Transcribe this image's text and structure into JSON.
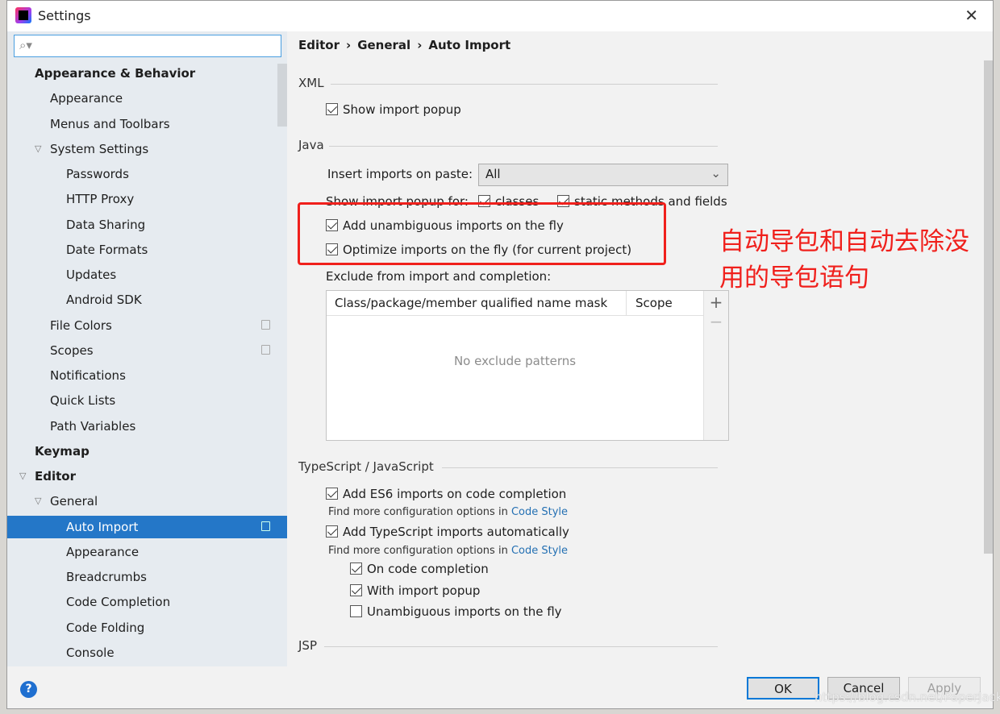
{
  "window": {
    "title": "Settings",
    "close": "✕"
  },
  "sidebar": {
    "search_placeholder": "",
    "items": [
      {
        "label": "Appearance & Behavior",
        "level": 0,
        "bold": true
      },
      {
        "label": "Appearance",
        "level": 1
      },
      {
        "label": "Menus and Toolbars",
        "level": 1
      },
      {
        "label": "System Settings",
        "level": 1,
        "expanded": true
      },
      {
        "label": "Passwords",
        "level": 2
      },
      {
        "label": "HTTP Proxy",
        "level": 2
      },
      {
        "label": "Data Sharing",
        "level": 2
      },
      {
        "label": "Date Formats",
        "level": 2
      },
      {
        "label": "Updates",
        "level": 2
      },
      {
        "label": "Android SDK",
        "level": 2
      },
      {
        "label": "File Colors",
        "level": 1,
        "copy": true
      },
      {
        "label": "Scopes",
        "level": 1,
        "copy": true
      },
      {
        "label": "Notifications",
        "level": 1
      },
      {
        "label": "Quick Lists",
        "level": 1
      },
      {
        "label": "Path Variables",
        "level": 1
      },
      {
        "label": "Keymap",
        "level": 0,
        "bold": true
      },
      {
        "label": "Editor",
        "level": 0,
        "bold": true,
        "expanded": true
      },
      {
        "label": "General",
        "level": 1,
        "expanded": true
      },
      {
        "label": "Auto Import",
        "level": 2,
        "selected": true,
        "copy": true
      },
      {
        "label": "Appearance",
        "level": 2
      },
      {
        "label": "Breadcrumbs",
        "level": 2
      },
      {
        "label": "Code Completion",
        "level": 2
      },
      {
        "label": "Code Folding",
        "level": 2
      },
      {
        "label": "Console",
        "level": 2
      }
    ]
  },
  "breadcrumb": [
    "Editor",
    "General",
    "Auto Import"
  ],
  "breadcrumb_sep": "›",
  "xml": {
    "title": "XML",
    "show_popup": {
      "label": "Show import popup",
      "checked": true
    }
  },
  "java": {
    "title": "Java",
    "insert_label": "Insert imports on paste:",
    "insert_value": "All",
    "popup_for_label": "Show import popup for:",
    "classes": {
      "label": "classes",
      "checked": true
    },
    "static": {
      "label": "static methods and fields",
      "checked": true
    },
    "unambiguous": {
      "label": "Add unambiguous imports on the fly",
      "checked": true
    },
    "optimize": {
      "label": "Optimize imports on the fly (for current project)",
      "checked": true
    },
    "exclude_label": "Exclude from import and completion:",
    "table": {
      "col1": "Class/package/member qualified name mask",
      "col2": "Scope",
      "empty": "No exclude patterns",
      "add": "+",
      "remove": "−"
    }
  },
  "ts": {
    "title": "TypeScript / JavaScript",
    "es6": {
      "label": "Add ES6 imports on code completion",
      "checked": true
    },
    "hint_text": "Find more configuration options in ",
    "hint_link": "Code Style",
    "tsauto": {
      "label": "Add TypeScript imports automatically",
      "checked": true
    },
    "on_completion": {
      "label": "On code completion",
      "checked": true
    },
    "with_popup": {
      "label": "With import popup",
      "checked": true
    },
    "unamb": {
      "label": "Unambiguous imports on the fly",
      "checked": false
    }
  },
  "jsp": {
    "title": "JSP"
  },
  "annotation": "自动导包和自动去除没用的导包语句",
  "footer": {
    "help": "?",
    "ok": "OK",
    "cancel": "Cancel",
    "apply": "Apply"
  },
  "watermark": "https://blog.csdn.net/PaperJack",
  "colors": {
    "accent": "#2477c8",
    "annotation": "#f0201c"
  }
}
